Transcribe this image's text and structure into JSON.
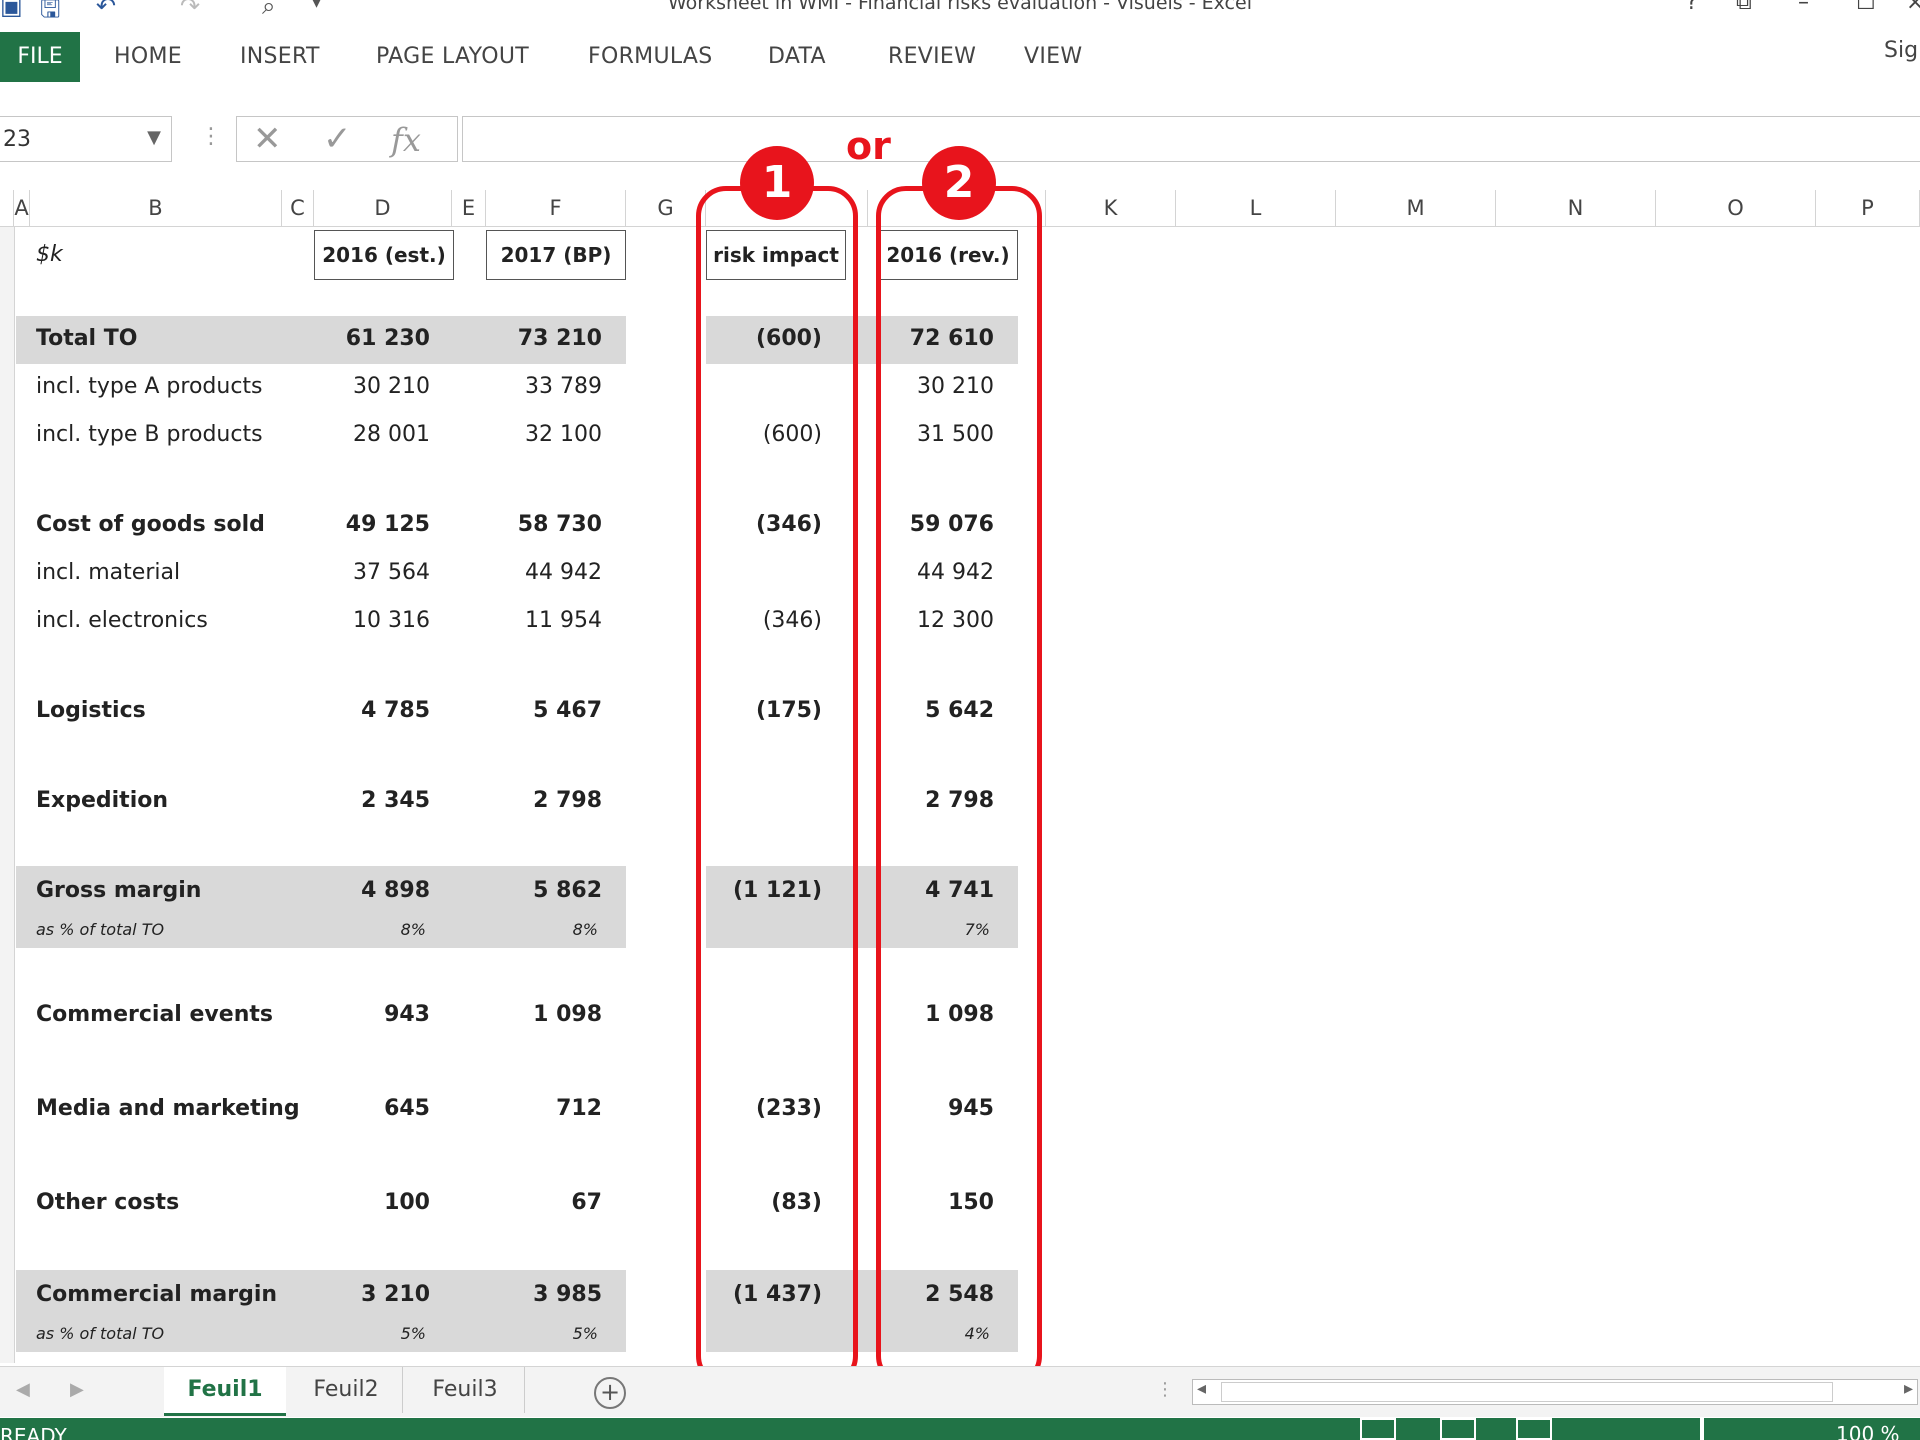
{
  "window": {
    "title": "Worksheet in WMI - Financial risks evaluation - Visuels - Excel"
  },
  "ribbon": {
    "tabs": [
      "FILE",
      "HOME",
      "INSERT",
      "PAGE LAYOUT",
      "FORMULAS",
      "DATA",
      "REVIEW",
      "VIEW"
    ],
    "signin": "Sign"
  },
  "formula_bar": {
    "name_box": "23",
    "fx_label": "fx",
    "content": ""
  },
  "columns": [
    "A",
    "B",
    "C",
    "D",
    "E",
    "F",
    "G",
    "",
    "",
    "K",
    "L",
    "M",
    "N",
    "O",
    "P"
  ],
  "sheet": {
    "unit_label": "$k",
    "headers": {
      "d": "2016 (est.)",
      "f": "2017 (BP)",
      "h": "risk impact",
      "j": "2016 (rev.)"
    },
    "rows": [
      {
        "label": "Total TO",
        "d": "61 230",
        "f": "73 210",
        "h": "(600)",
        "j": "72 610",
        "bold": true
      },
      {
        "label": "incl. type A products",
        "d": "30 210",
        "f": "33 789",
        "h": "",
        "j": "30 210",
        "bold": false
      },
      {
        "label": "incl. type B products",
        "d": "28 001",
        "f": "32 100",
        "h": "(600)",
        "j": "31 500",
        "bold": false
      },
      {
        "label": "Cost of goods sold",
        "d": "49 125",
        "f": "58 730",
        "h": "(346)",
        "j": "59 076",
        "bold": true
      },
      {
        "label": "incl. material",
        "d": "37 564",
        "f": "44 942",
        "h": "",
        "j": "44 942",
        "bold": false
      },
      {
        "label": "incl. electronics",
        "d": "10 316",
        "f": "11 954",
        "h": "(346)",
        "j": "12 300",
        "bold": false
      },
      {
        "label": "Logistics",
        "d": "4 785",
        "f": "5 467",
        "h": "(175)",
        "j": "5 642",
        "bold": true
      },
      {
        "label": "Expedition",
        "d": "2 345",
        "f": "2 798",
        "h": "",
        "j": "2 798",
        "bold": true
      },
      {
        "label": "Gross margin",
        "d": "4 898",
        "f": "5 862",
        "h": "(1 121)",
        "j": "4 741",
        "bold": true
      },
      {
        "label": "as % of total TO",
        "d": "8%",
        "f": "8%",
        "h": "",
        "j": "7%",
        "bold": false,
        "pct": true
      },
      {
        "label": "Commercial events",
        "d": "943",
        "f": "1 098",
        "h": "",
        "j": "1 098",
        "bold": true
      },
      {
        "label": "Media and marketing",
        "d": "645",
        "f": "712",
        "h": "(233)",
        "j": "945",
        "bold": true
      },
      {
        "label": "Other costs",
        "d": "100",
        "f": "67",
        "h": "(83)",
        "j": "150",
        "bold": true
      },
      {
        "label": "Commercial margin",
        "d": "3 210",
        "f": "3 985",
        "h": "(1 437)",
        "j": "2 548",
        "bold": true
      },
      {
        "label": "as % of total TO",
        "d": "5%",
        "f": "5%",
        "h": "",
        "j": "4%",
        "bold": false,
        "pct": true
      }
    ]
  },
  "annotations": {
    "option1": "1",
    "option2": "2",
    "or": "or",
    "color": "#e8141c"
  },
  "sheet_tabs": [
    "Feuil1",
    "Feuil2",
    "Feuil3"
  ],
  "status": {
    "mode": "READY",
    "zoom": "100 %"
  },
  "colors": {
    "excel_green": "#217346",
    "band_gray": "#d9d9d9"
  }
}
